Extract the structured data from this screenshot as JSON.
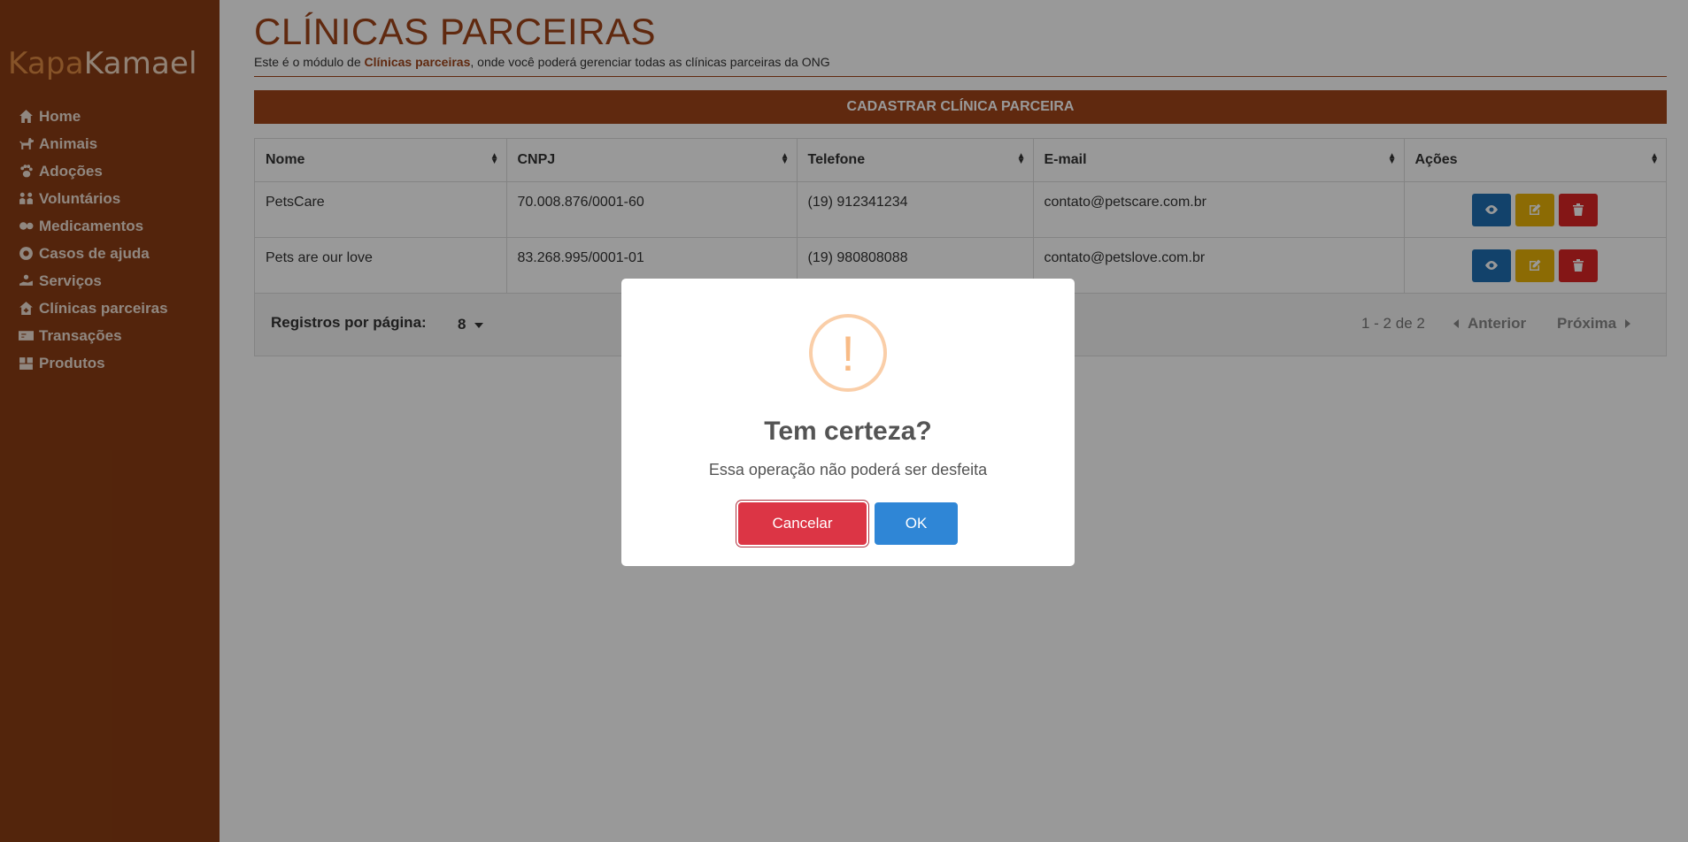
{
  "brand": {
    "part1": "Kapa",
    "part2": "Kamael"
  },
  "sidebar": {
    "items": [
      {
        "label": "Home",
        "icon": "home-icon"
      },
      {
        "label": "Animais",
        "icon": "dog-icon"
      },
      {
        "label": "Adoções",
        "icon": "paw-icon"
      },
      {
        "label": "Voluntários",
        "icon": "people-icon"
      },
      {
        "label": "Medicamentos",
        "icon": "pills-icon"
      },
      {
        "label": "Casos de ajuda",
        "icon": "lifebuoy-icon"
      },
      {
        "label": "Serviços",
        "icon": "hand-icon"
      },
      {
        "label": "Clínicas parceiras",
        "icon": "clinic-icon"
      },
      {
        "label": "Transações",
        "icon": "money-icon"
      },
      {
        "label": "Produtos",
        "icon": "boxes-icon"
      }
    ]
  },
  "page": {
    "title": "CLÍNICAS PARCEIRAS",
    "subtitle_pre": "Este é o módulo de ",
    "subtitle_bold": "Clínicas parceiras",
    "subtitle_post": ", onde você poderá gerenciar todas as clínicas parceiras da ONG",
    "add_button": "CADASTRAR CLÍNICA PARCEIRA"
  },
  "table": {
    "columns": [
      "Nome",
      "CNPJ",
      "Telefone",
      "E-mail",
      "Ações"
    ],
    "rows": [
      {
        "nome": "PetsCare",
        "cnpj": "70.008.876/0001-60",
        "telefone": "(19) 912341234",
        "email": "contato@petscare.com.br"
      },
      {
        "nome": "Pets are our love",
        "cnpj": "83.268.995/0001-01",
        "telefone": "(19) 980808088",
        "email": "contato@petslove.com.br"
      }
    ]
  },
  "pagination": {
    "rows_per_page_label": "Registros por página:",
    "rows_per_page_value": "8",
    "range": "1 - 2 de 2",
    "prev": "Anterior",
    "next": "Próxima"
  },
  "modal": {
    "icon": "!",
    "title": "Tem certeza?",
    "text": "Essa operação não poderá ser desfeita",
    "cancel": "Cancelar",
    "ok": "OK"
  },
  "colors": {
    "sidebar": "#8b3d14",
    "accent": "#a0451a",
    "cancel": "#dc3545",
    "ok": "#2f86d6",
    "view": "#1f6fb2",
    "edit": "#eab308",
    "delete": "#dc2626",
    "warning": "#f8bb86"
  }
}
